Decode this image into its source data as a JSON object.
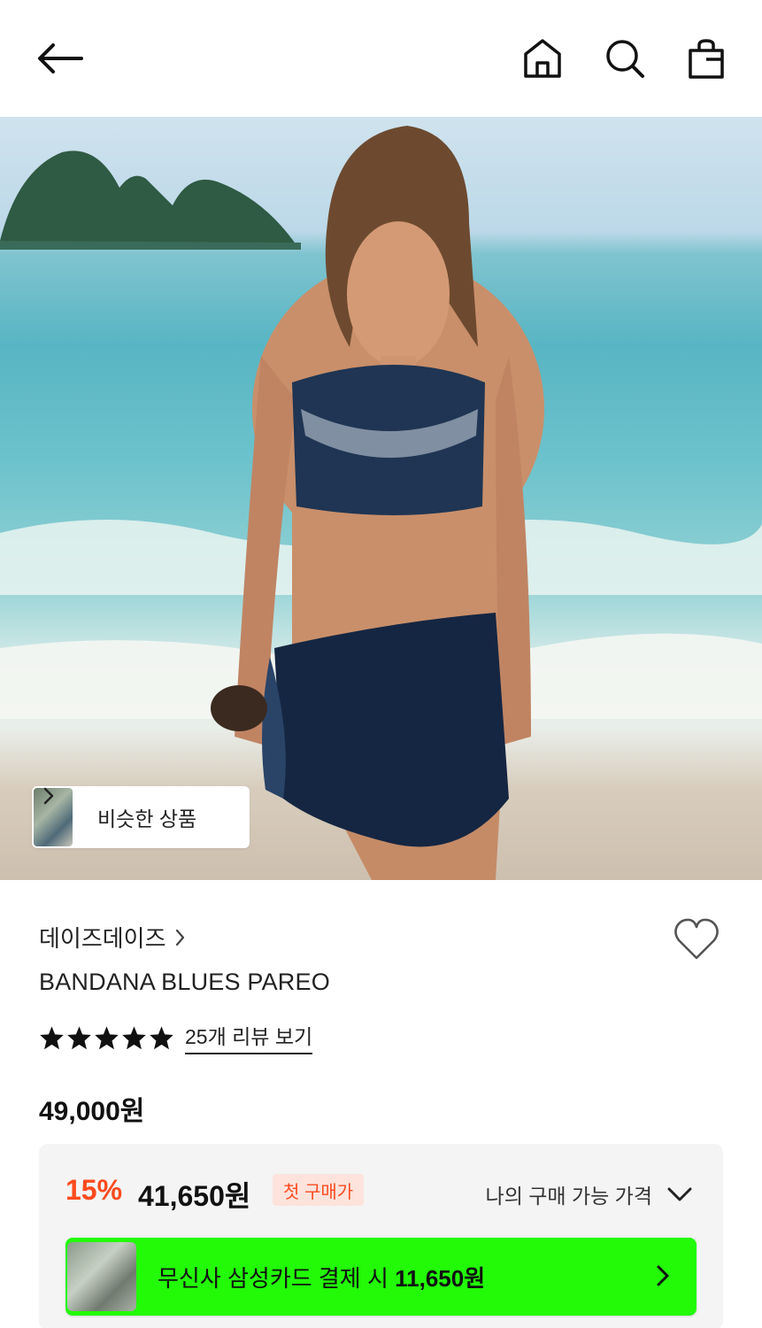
{
  "header": {
    "back_icon": "arrow-left-icon",
    "home_icon": "home-icon",
    "search_icon": "search-icon",
    "bag_icon": "shopping-bag-icon"
  },
  "hero": {
    "similar_label": "비슷한 상품"
  },
  "product": {
    "brand": "데이즈데이즈",
    "name": "BANDANA BLUES PAREO",
    "rating_stars": 5,
    "review_link": "25개 리뷰 보기",
    "price": "49,000원"
  },
  "price_box": {
    "discount": "15%",
    "final_price": "41,650원",
    "badge": "첫 구매가",
    "my_price_label": "나의 구매 가능 가격",
    "card_text": "무신사 삼성카드 결제 시",
    "card_amount": "11,650원"
  },
  "colors": {
    "accent_red": "#ff4b1f",
    "banner_green": "#22fa08",
    "badge_bg": "#fde3dc"
  }
}
